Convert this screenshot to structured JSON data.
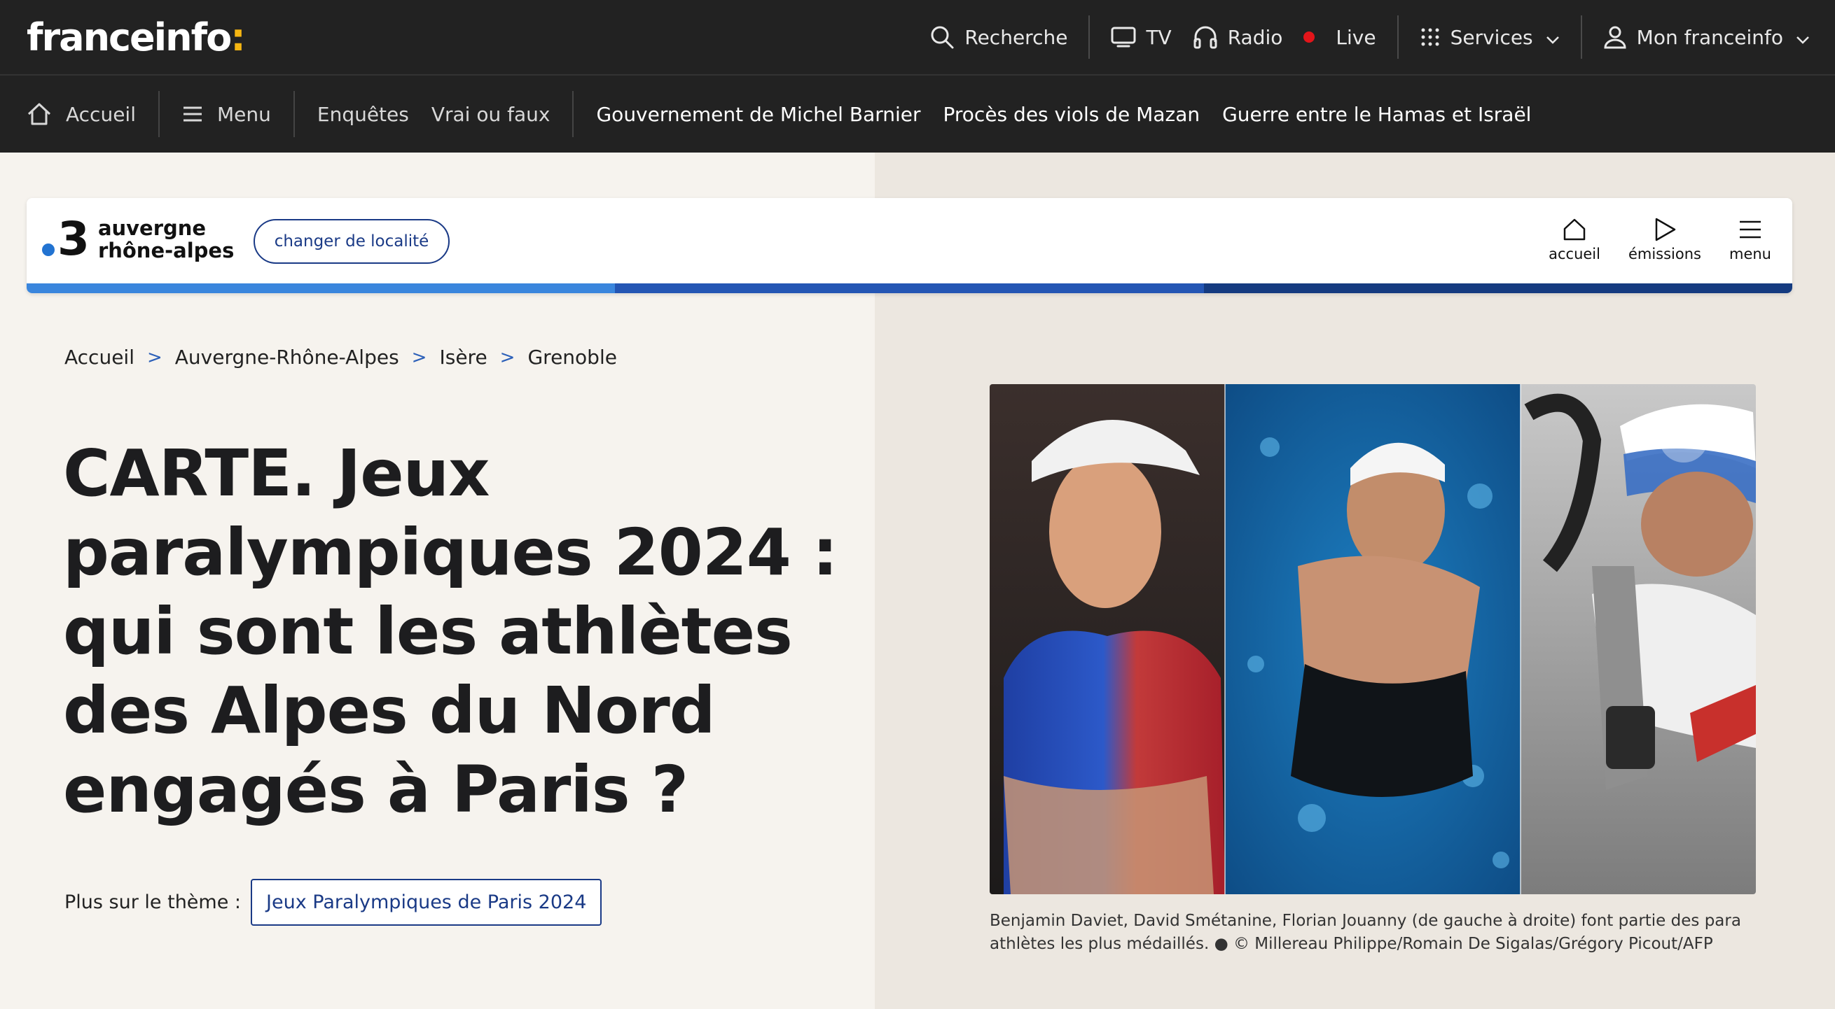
{
  "header": {
    "logo_text": "franceinfo",
    "logo_colon": ":",
    "search_label": "Recherche",
    "tv_label": "TV",
    "radio_label": "Radio",
    "live_label": "Live",
    "services_label": "Services",
    "account_label": "Mon franceinfo"
  },
  "subnav": {
    "home_label": "Accueil",
    "menu_label": "Menu",
    "items": [
      "Enquêtes",
      "Vrai ou faux"
    ],
    "topics": [
      "Gouvernement de Michel Barnier",
      "Procès des viols de Mazan",
      "Guerre entre le Hamas et Israël"
    ]
  },
  "regional": {
    "channel_number": "3",
    "region_line1": "auvergne",
    "region_line2": "rhône-alpes",
    "change_label": "changer de localité",
    "nav": [
      "accueil",
      "émissions",
      "menu"
    ]
  },
  "breadcrumb": [
    "Accueil",
    "Auvergne-Rhône-Alpes",
    "Isère",
    "Grenoble"
  ],
  "breadcrumb_sep": ">",
  "article": {
    "title": "CARTE. Jeux paralympiques 2024 : qui sont les athlètes des Alpes du Nord engagés à Paris ?",
    "theme_label": "Plus sur le thème :",
    "theme_tag": "Jeux Paralympiques de Paris 2024",
    "caption": "Benjamin Daviet, David Smétanine, Florian Jouanny (de gauche à droite) font partie des para athlètes les plus médaillés. ● © Millereau Philippe/Romain De Sigalas/Grégory Picout/AFP"
  },
  "colors": {
    "topbar": "#222222",
    "accent_yellow": "#f6b612",
    "live_red": "#e3151a",
    "link_blue": "#1a3a86",
    "stripe": [
      "#3a86dd",
      "#2456b4",
      "#153b80"
    ]
  }
}
